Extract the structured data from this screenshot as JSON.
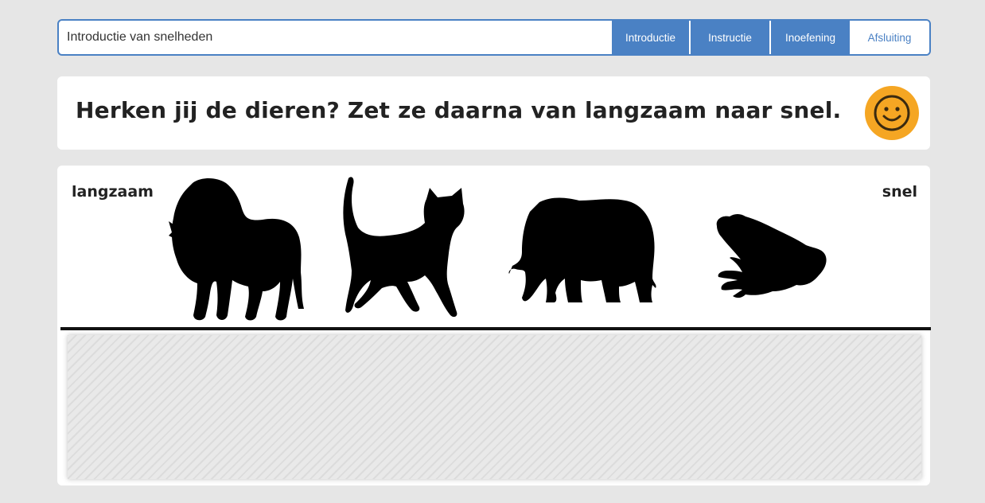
{
  "header": {
    "lesson_title": "Introductie van snelheden",
    "tabs": [
      {
        "label": "Introductie",
        "active": true
      },
      {
        "label": "Instructie",
        "active": true
      },
      {
        "label": "Inoefening",
        "active": true
      },
      {
        "label": "Afsluiting",
        "active": false
      }
    ]
  },
  "question": {
    "text": "Herken jij de dieren? Zet ze daarna van langzaam naar snel.",
    "feedback_icon": "smiley-face-icon"
  },
  "exercise": {
    "slow_label": "langzaam",
    "fast_label": "snel",
    "animals": [
      "lion",
      "cat",
      "elephant",
      "frog"
    ]
  },
  "colors": {
    "accent": "#4a81c4",
    "smiley": "#f5a623",
    "background": "#e6e6e6"
  }
}
